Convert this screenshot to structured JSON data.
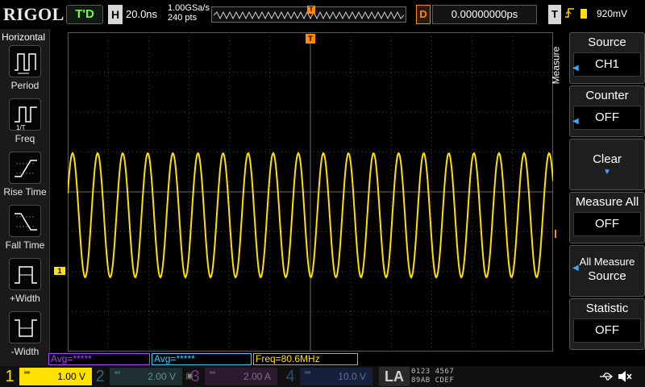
{
  "header": {
    "brand": "RIGOL",
    "trigger_status": "T'D",
    "horizontal_label": "H",
    "timebase": "20.0ns",
    "sample_rate": "1.00GSa/s",
    "points": "240 pts",
    "memory_trigger_marker": "T",
    "delay_label": "D",
    "delay_value": "0.00000000ps",
    "trigger_label": "T",
    "trigger_slope_icon": "rising-edge-icon",
    "trigger_level": "920mV"
  },
  "left_panel": {
    "title": "Horizontal",
    "items": [
      {
        "label": "Period",
        "icon": "period-icon"
      },
      {
        "label": "Freq",
        "icon": "frequency-icon"
      },
      {
        "label": "Rise Time",
        "icon": "rise-time-icon"
      },
      {
        "label": "Fall Time",
        "icon": "fall-time-icon"
      },
      {
        "label": "+Width",
        "icon": "positive-width-icon"
      },
      {
        "label": "-Width",
        "icon": "negative-width-icon"
      }
    ]
  },
  "screen": {
    "trigger_position_marker": "T",
    "ch1_marker": "1",
    "trigger_level_marker": "T",
    "waveform_color": "#ffe100"
  },
  "menu": {
    "tab_label": "Measure",
    "items": [
      {
        "label": "Source",
        "value": "CH1"
      },
      {
        "label": "Counter",
        "value": "OFF"
      },
      {
        "label": "Clear",
        "value": ""
      },
      {
        "label": "Measure All",
        "value": "OFF"
      },
      {
        "label": "All Measure",
        "value": "Source"
      },
      {
        "label": "Statistic",
        "value": "OFF"
      }
    ]
  },
  "measurements": [
    {
      "text": "Avg=*****",
      "color": "#aa44ff"
    },
    {
      "text": "Avg=*****",
      "color": "#38d0ff"
    },
    {
      "text": "Freq=80.6MHz",
      "color": "#ffe100"
    }
  ],
  "channels": [
    {
      "number": "1",
      "scale": "1.00 V"
    },
    {
      "number": "2",
      "scale": "2.00 V"
    },
    {
      "number": "3",
      "scale": "2.00 A"
    },
    {
      "number": "4",
      "scale": "10.0 V"
    }
  ],
  "logic_analyzer": {
    "label": "LA",
    "bits_top": "0123 4567",
    "bits_bottom": "89AB CDEF"
  },
  "status_icons": [
    "usb-icon",
    "speaker-muted-icon"
  ]
}
